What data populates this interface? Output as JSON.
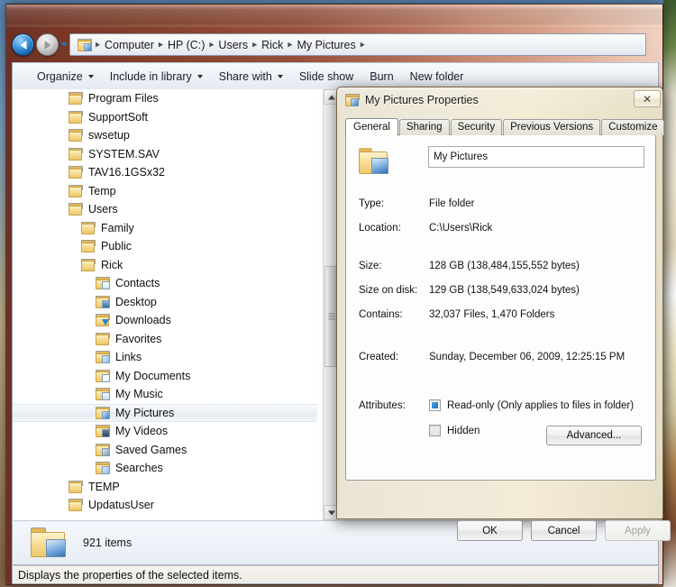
{
  "window": {
    "navigation": {
      "back_tooltip": "Back",
      "forward_tooltip": "Forward",
      "history_tooltip": "Recent pages",
      "breadcrumbs": [
        "Computer",
        "HP (C:)",
        "Users",
        "Rick",
        "My Pictures"
      ],
      "separator": "▸"
    },
    "toolbar": {
      "items": [
        {
          "label": "Organize",
          "has_caret": true
        },
        {
          "label": "Include in library",
          "has_caret": true
        },
        {
          "label": "Share with",
          "has_caret": true
        },
        {
          "label": "Slide show",
          "has_caret": false
        },
        {
          "label": "Burn",
          "has_caret": false
        },
        {
          "label": "New folder",
          "has_caret": false
        }
      ]
    },
    "tree": {
      "items": [
        {
          "label": "Program Files",
          "indent": 1,
          "icon": "folder-icon",
          "selected": false
        },
        {
          "label": "SupportSoft",
          "indent": 1,
          "icon": "folder-icon",
          "selected": false
        },
        {
          "label": "swsetup",
          "indent": 1,
          "icon": "folder-icon",
          "selected": false
        },
        {
          "label": "SYSTEM.SAV",
          "indent": 1,
          "icon": "folder-icon",
          "selected": false
        },
        {
          "label": "TAV16.1GSx32",
          "indent": 1,
          "icon": "folder-icon",
          "selected": false
        },
        {
          "label": "Temp",
          "indent": 1,
          "icon": "folder-icon",
          "selected": false
        },
        {
          "label": "Users",
          "indent": 1,
          "icon": "folder-icon",
          "selected": false
        },
        {
          "label": "Family",
          "indent": 2,
          "icon": "folder-icon",
          "selected": false
        },
        {
          "label": "Public",
          "indent": 2,
          "icon": "folder-icon",
          "selected": false
        },
        {
          "label": "Rick",
          "indent": 2,
          "icon": "folder-icon",
          "selected": false
        },
        {
          "label": "Contacts",
          "indent": 3,
          "icon": "contacts-folder-icon",
          "selected": false
        },
        {
          "label": "Desktop",
          "indent": 3,
          "icon": "desktop-folder-icon",
          "selected": false
        },
        {
          "label": "Downloads",
          "indent": 3,
          "icon": "downloads-folder-icon",
          "selected": false
        },
        {
          "label": "Favorites",
          "indent": 3,
          "icon": "favorites-folder-icon",
          "selected": false
        },
        {
          "label": "Links",
          "indent": 3,
          "icon": "links-folder-icon",
          "selected": false
        },
        {
          "label": "My Documents",
          "indent": 3,
          "icon": "documents-folder-icon",
          "selected": false
        },
        {
          "label": "My Music",
          "indent": 3,
          "icon": "music-folder-icon",
          "selected": false
        },
        {
          "label": "My Pictures",
          "indent": 3,
          "icon": "pictures-folder-icon",
          "selected": true
        },
        {
          "label": "My Videos",
          "indent": 3,
          "icon": "videos-folder-icon",
          "selected": false
        },
        {
          "label": "Saved Games",
          "indent": 3,
          "icon": "saved-games-folder-icon",
          "selected": false
        },
        {
          "label": "Searches",
          "indent": 3,
          "icon": "searches-folder-icon",
          "selected": false
        },
        {
          "label": "TEMP",
          "indent": 1,
          "icon": "folder-icon",
          "selected": false
        },
        {
          "label": "UpdatusUser",
          "indent": 1,
          "icon": "folder-icon",
          "selected": false
        }
      ]
    },
    "details_pane": {
      "item_count_text": "921 items"
    },
    "status_bar": {
      "text": "Displays the properties of the selected items."
    }
  },
  "dialog": {
    "title": "My Pictures Properties",
    "title_icon": "pictures-folder-icon",
    "close_label": "✕",
    "tabs": [
      {
        "label": "General",
        "active": true
      },
      {
        "label": "Sharing",
        "active": false
      },
      {
        "label": "Security",
        "active": false
      },
      {
        "label": "Previous Versions",
        "active": false
      },
      {
        "label": "Customize",
        "active": false
      }
    ],
    "general": {
      "name_value": "My Pictures",
      "rows": [
        {
          "label": "Type:",
          "value": "File folder"
        },
        {
          "label": "Location:",
          "value": "C:\\Users\\Rick"
        },
        {
          "label": "Size:",
          "value": "128 GB (138,484,155,552 bytes)"
        },
        {
          "label": "Size on disk:",
          "value": "129 GB (138,549,633,024 bytes)"
        },
        {
          "label": "Contains:",
          "value": "32,037 Files, 1,470 Folders"
        }
      ],
      "created_label": "Created:",
      "created_value": "Sunday, December 06, 2009, 12:25:15 PM",
      "attributes_label": "Attributes:",
      "readonly_label": "Read-only (Only applies to files in folder)",
      "readonly_state": "indeterminate",
      "hidden_label": "Hidden",
      "hidden_state": "unchecked",
      "advanced_label": "Advanced..."
    },
    "buttons": {
      "ok": "OK",
      "cancel": "Cancel",
      "apply": "Apply",
      "apply_disabled": true
    }
  },
  "theme": {
    "frame_color": "#8a4630",
    "dialog_color": "#efe9d8",
    "accent_blue": "#1f6fb5",
    "selection_color": "#eef2f7"
  }
}
